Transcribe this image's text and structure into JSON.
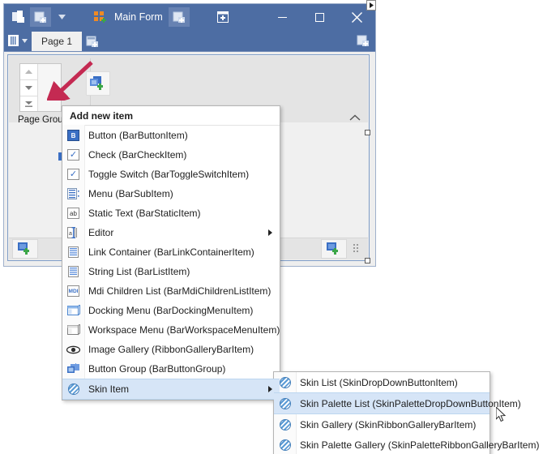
{
  "window": {
    "title": "Main Form",
    "tab_label": "Page 1",
    "group_label": "Page Grou...",
    "caption_buttons": [
      "minimize",
      "maximize",
      "close"
    ]
  },
  "context_menu": {
    "header": "Add new item",
    "items": [
      {
        "label": "Button (BarButtonItem)",
        "icon": "button-icon",
        "submenu": false,
        "selected": false
      },
      {
        "label": "Check (BarCheckItem)",
        "icon": "check-icon",
        "submenu": false,
        "selected": false
      },
      {
        "label": "Toggle Switch (BarToggleSwitchItem)",
        "icon": "toggle-switch-icon",
        "submenu": false,
        "selected": false
      },
      {
        "label": "Menu (BarSubItem)",
        "icon": "menu-icon",
        "submenu": false,
        "selected": false
      },
      {
        "label": "Static Text (BarStaticItem)",
        "icon": "static-text-icon",
        "submenu": false,
        "selected": false
      },
      {
        "label": "Editor",
        "icon": "editor-icon",
        "submenu": true,
        "selected": false
      },
      {
        "label": "Link Container (BarLinkContainerItem)",
        "icon": "link-container-icon",
        "submenu": false,
        "selected": false
      },
      {
        "label": "String List (BarListItem)",
        "icon": "string-list-icon",
        "submenu": false,
        "selected": false
      },
      {
        "label": "Mdi Children List (BarMdiChildrenListItem)",
        "icon": "mdi-icon",
        "submenu": false,
        "selected": false
      },
      {
        "label": "Docking Menu (BarDockingMenuItem)",
        "icon": "docking-menu-icon",
        "submenu": false,
        "selected": false
      },
      {
        "label": "Workspace Menu (BarWorkspaceMenuItem)",
        "icon": "workspace-menu-icon",
        "submenu": false,
        "selected": false
      },
      {
        "label": "Image Gallery (RibbonGalleryBarItem)",
        "icon": "image-gallery-icon",
        "submenu": false,
        "selected": false
      },
      {
        "label": "Button Group (BarButtonGroup)",
        "icon": "button-group-icon",
        "submenu": false,
        "selected": false
      },
      {
        "label": "Skin Item",
        "icon": "skin-icon",
        "submenu": true,
        "selected": true
      }
    ]
  },
  "submenu": {
    "items": [
      {
        "label": "Skin List (SkinDropDownButtonItem)",
        "icon": "skin-icon",
        "selected": false
      },
      {
        "label": "Skin Palette List (SkinPaletteDropDownButtonItem)",
        "icon": "skin-icon",
        "selected": true
      },
      {
        "label": "Skin Gallery (SkinRibbonGalleryBarItem)",
        "icon": "skin-icon",
        "selected": false
      },
      {
        "label": "Skin Palette Gallery (SkinPaletteRibbonGalleryBarItem)",
        "icon": "skin-icon",
        "selected": false
      }
    ]
  },
  "colors": {
    "titlebar": "#4d6da3",
    "selection": "#d6e5f7",
    "annotation_arrow": "#c42a52",
    "accent_green": "#3ba648",
    "accent_blue": "#3a6fc4"
  }
}
